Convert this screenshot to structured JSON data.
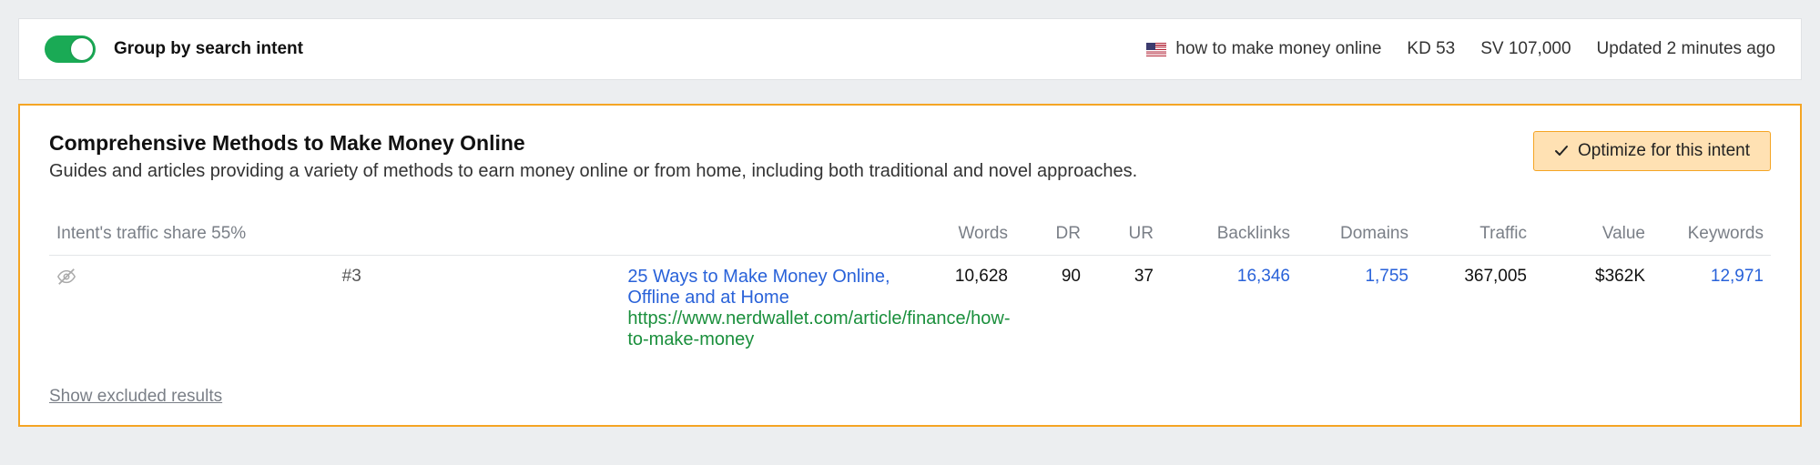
{
  "topbar": {
    "toggle_label": "Group by search intent",
    "keyword": "how to make money online",
    "kd_label": "KD 53",
    "sv_label": "SV 107,000",
    "updated_label": "Updated 2 minutes ago"
  },
  "intent": {
    "title": "Comprehensive Methods to Make Money Online",
    "description": "Guides and articles providing a variety of methods to earn money online or from home, including both traditional and novel approaches.",
    "optimize_label": "Optimize for this intent",
    "traffic_share_label": "Intent's traffic share 55%",
    "columns": {
      "words": "Words",
      "dr": "DR",
      "ur": "UR",
      "backlinks": "Backlinks",
      "domains": "Domains",
      "traffic": "Traffic",
      "value": "Value",
      "keywords": "Keywords"
    },
    "rows": [
      {
        "rank": "#3",
        "title": "25 Ways to Make Money Online, Offline and at Home",
        "url": "https://www.nerdwallet.com/article/finance/how-to-make-money",
        "words": "10,628",
        "dr": "90",
        "ur": "37",
        "backlinks": "16,346",
        "domains": "1,755",
        "traffic": "367,005",
        "value": "$362K",
        "keywords": "12,971"
      }
    ],
    "show_excluded_label": "Show excluded results"
  }
}
